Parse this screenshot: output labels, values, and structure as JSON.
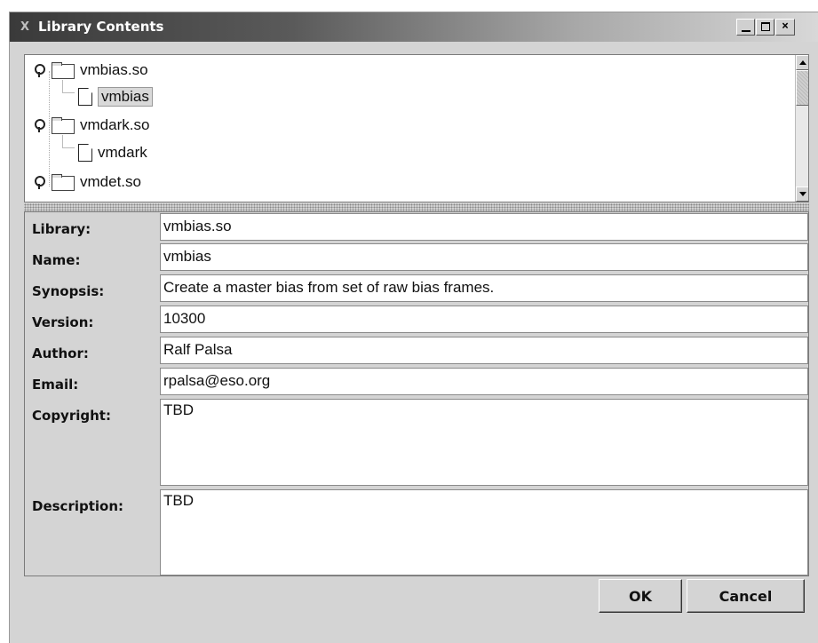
{
  "window": {
    "title": "Library Contents",
    "logo": "X"
  },
  "tree": {
    "items": [
      {
        "kind": "library",
        "label": "vmbias.so",
        "expanded": true
      },
      {
        "kind": "recipe",
        "label": "vmbias",
        "selected": true
      },
      {
        "kind": "library",
        "label": "vmdark.so",
        "expanded": true
      },
      {
        "kind": "recipe",
        "label": "vmdark",
        "selected": false
      },
      {
        "kind": "library",
        "label": "vmdet.so",
        "expanded": true
      }
    ]
  },
  "details": {
    "library": {
      "label": "Library:",
      "value": "vmbias.so"
    },
    "name": {
      "label": "Name:",
      "value": "vmbias"
    },
    "synopsis": {
      "label": "Synopsis:",
      "value": "Create a master bias from set of raw bias frames."
    },
    "version": {
      "label": "Version:",
      "value": "10300"
    },
    "author": {
      "label": "Author:",
      "value": "Ralf Palsa"
    },
    "email": {
      "label": "Email:",
      "value": "rpalsa@eso.org"
    },
    "copyright": {
      "label": "Copyright:",
      "value": "TBD"
    },
    "description": {
      "label": "Description:",
      "value": "TBD"
    }
  },
  "buttons": {
    "ok": "OK",
    "cancel": "Cancel"
  },
  "icons": {
    "minimize": "minimize-icon",
    "maximize": "maximize-icon",
    "close": "close-icon",
    "folder": "folder-icon",
    "file": "file-icon"
  }
}
